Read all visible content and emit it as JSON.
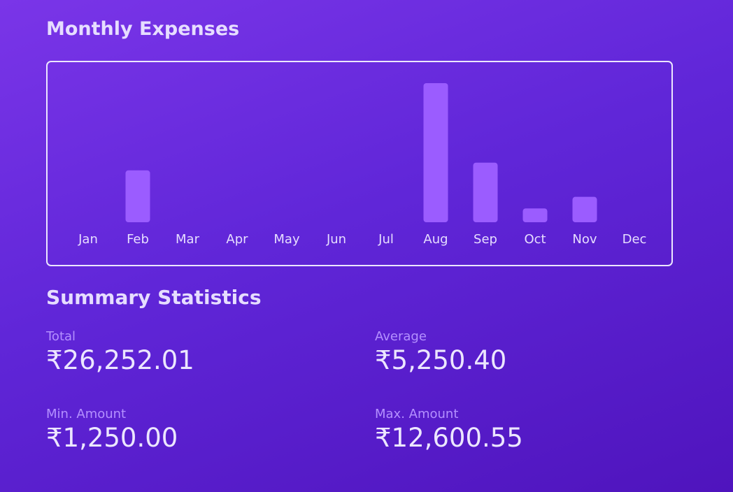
{
  "header": {
    "title": "Monthly Expenses"
  },
  "chart_data": {
    "type": "bar",
    "categories": [
      "Jan",
      "Feb",
      "Mar",
      "Apr",
      "May",
      "Jun",
      "Jul",
      "Aug",
      "Sep",
      "Oct",
      "Nov",
      "Dec"
    ],
    "values": [
      0,
      4700,
      0,
      0,
      0,
      0,
      0,
      12600.55,
      5400,
      1250,
      2300,
      0
    ],
    "title": "",
    "xlabel": "",
    "ylabel": "",
    "ylim": [
      0,
      12600.55
    ],
    "grid": false,
    "legend": "none",
    "colors": {
      "bar": "#9b5cff",
      "border": "#ece6ff",
      "label": "#e6ddff"
    }
  },
  "summary": {
    "title": "Summary Statistics",
    "total_label": "Total",
    "total_value": "₹26,252.01",
    "average_label": "Average",
    "average_value": "₹5,250.40",
    "min_label": "Min. Amount",
    "min_value": "₹1,250.00",
    "max_label": "Max. Amount",
    "max_value": "₹12,600.55"
  }
}
